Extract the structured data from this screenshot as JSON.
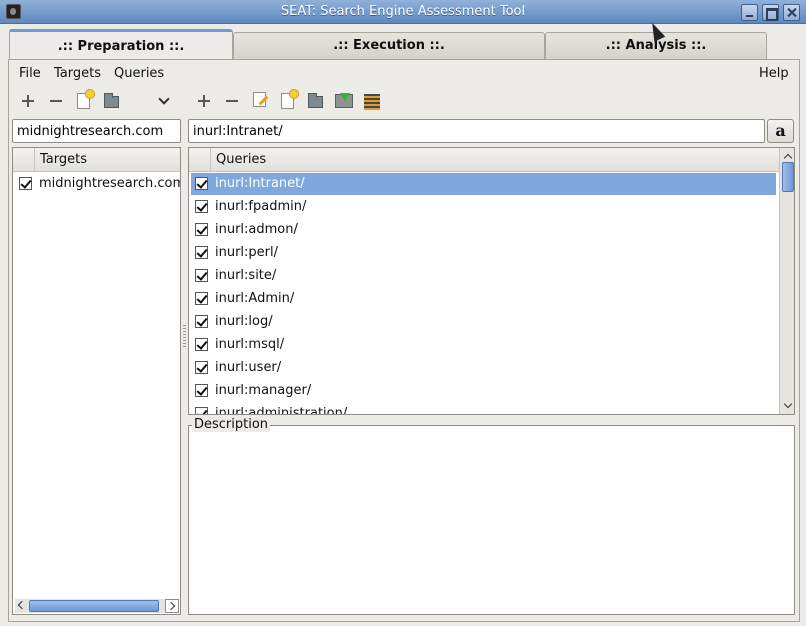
{
  "window": {
    "title": "SEAT: Search Engine Assessment Tool"
  },
  "tabs": [
    {
      "label": ".:: Preparation ::.",
      "active": true
    },
    {
      "label": ".:: Execution ::.",
      "active": false
    },
    {
      "label": ".:: Analysis ::.",
      "active": false
    }
  ],
  "menu": {
    "file": "File",
    "targets": "Targets",
    "queries": "Queries",
    "help": "Help"
  },
  "targets_input": {
    "value": "midnightresearch.com"
  },
  "query_input": {
    "value": "inurl:Intranet/"
  },
  "search_button": {
    "label": "a"
  },
  "targets": {
    "header": "Targets",
    "items": [
      {
        "label": "midnightresearch.com",
        "checked": true
      }
    ]
  },
  "queries": {
    "header": "Queries",
    "items": [
      {
        "label": "inurl:Intranet/",
        "checked": true,
        "selected": true
      },
      {
        "label": "inurl:fpadmin/",
        "checked": true
      },
      {
        "label": "inurl:admon/",
        "checked": true
      },
      {
        "label": "inurl:perl/",
        "checked": true
      },
      {
        "label": "inurl:site/",
        "checked": true
      },
      {
        "label": "inurl:Admin/",
        "checked": true
      },
      {
        "label": "inurl:log/",
        "checked": true
      },
      {
        "label": "inurl:msql/",
        "checked": true
      },
      {
        "label": "inurl:user/",
        "checked": true
      },
      {
        "label": "inurl:manager/",
        "checked": true
      },
      {
        "label": "inurl:administration/",
        "checked": true
      }
    ]
  },
  "description": {
    "label": "Description"
  },
  "colors": {
    "titlebar": "#6f96c9",
    "selection": "#7fa8dc"
  }
}
